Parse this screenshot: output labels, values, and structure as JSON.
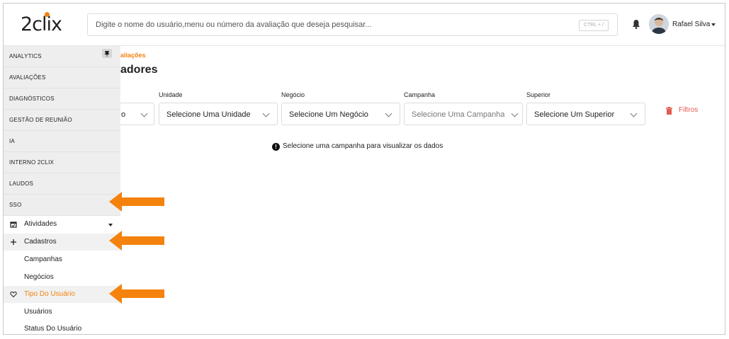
{
  "header": {
    "logo": "2clix",
    "search_placeholder": "Digite o nome do usuário,menu ou número da avaliação que deseja pesquisar...",
    "search_shortcut": "CTRL + /",
    "user_name": "Rafael Silva",
    "notification_icon": "bell-icon",
    "accent_color": "#f5820d"
  },
  "sidebar": {
    "groups": [
      {
        "label": "ANALYTICS"
      },
      {
        "label": "AVALIAÇÕES"
      },
      {
        "label": "DIAGNÓSTICOS"
      },
      {
        "label": "GESTÃO DE REUNIÃO"
      },
      {
        "label": "IA"
      },
      {
        "label": "INTERNO 2CLIX"
      },
      {
        "label": "LAUDOS"
      },
      {
        "label": "SSO"
      }
    ],
    "items": [
      {
        "label": "Atividades",
        "icon": "calendar-icon"
      },
      {
        "label": "Cadastros",
        "icon": "plus-icon"
      },
      {
        "label": "Campanhas"
      },
      {
        "label": "Negócios"
      },
      {
        "label": "Tipo Do Usuário",
        "icon": "heart-icon"
      },
      {
        "label": "Usuários"
      },
      {
        "label": "Status Do Usuário"
      }
    ]
  },
  "main": {
    "breadcrumb": "aliações",
    "title": "adores",
    "filters": [
      {
        "label": "",
        "value": "o"
      },
      {
        "label": "Unidade",
        "value": "Selecione Uma Unidade"
      },
      {
        "label": "Negócio",
        "value": "Selecione Um Negócio"
      },
      {
        "label": "Campanha",
        "value": "Selecione Uma Campanha"
      },
      {
        "label": "Superior",
        "value": "Selecione Um Superior"
      }
    ],
    "filters_button": "Filtros",
    "notice": "Selecione uma campanha para visualizar os dados"
  }
}
